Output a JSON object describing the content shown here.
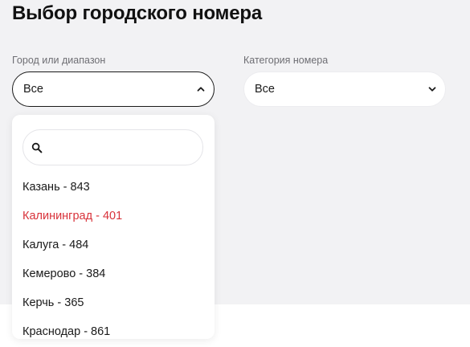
{
  "page": {
    "title": "Выбор городского номера"
  },
  "city_filter": {
    "label": "Город или диапазон",
    "selected": "Все",
    "expanded": true,
    "chevron_icon": "chevron-up-icon"
  },
  "category_filter": {
    "label": "Категория номера",
    "selected": "Все",
    "expanded": false,
    "chevron_icon": "chevron-down-icon"
  },
  "dropdown": {
    "search": {
      "icon": "search-icon",
      "value": "",
      "placeholder": ""
    },
    "options": [
      {
        "label": "Казань - 843",
        "highlighted": false
      },
      {
        "label": "Калининград - 401",
        "highlighted": true
      },
      {
        "label": "Калуга - 484",
        "highlighted": false
      },
      {
        "label": "Кемерово - 384",
        "highlighted": false
      },
      {
        "label": "Керчь - 365",
        "highlighted": false
      },
      {
        "label": "Краснодар - 861",
        "highlighted": false
      }
    ]
  },
  "colors": {
    "background": "#f2f2f4",
    "surface": "#ffffff",
    "text": "#1a1a1a",
    "label": "#6e6e73",
    "highlight": "#d8323a"
  }
}
